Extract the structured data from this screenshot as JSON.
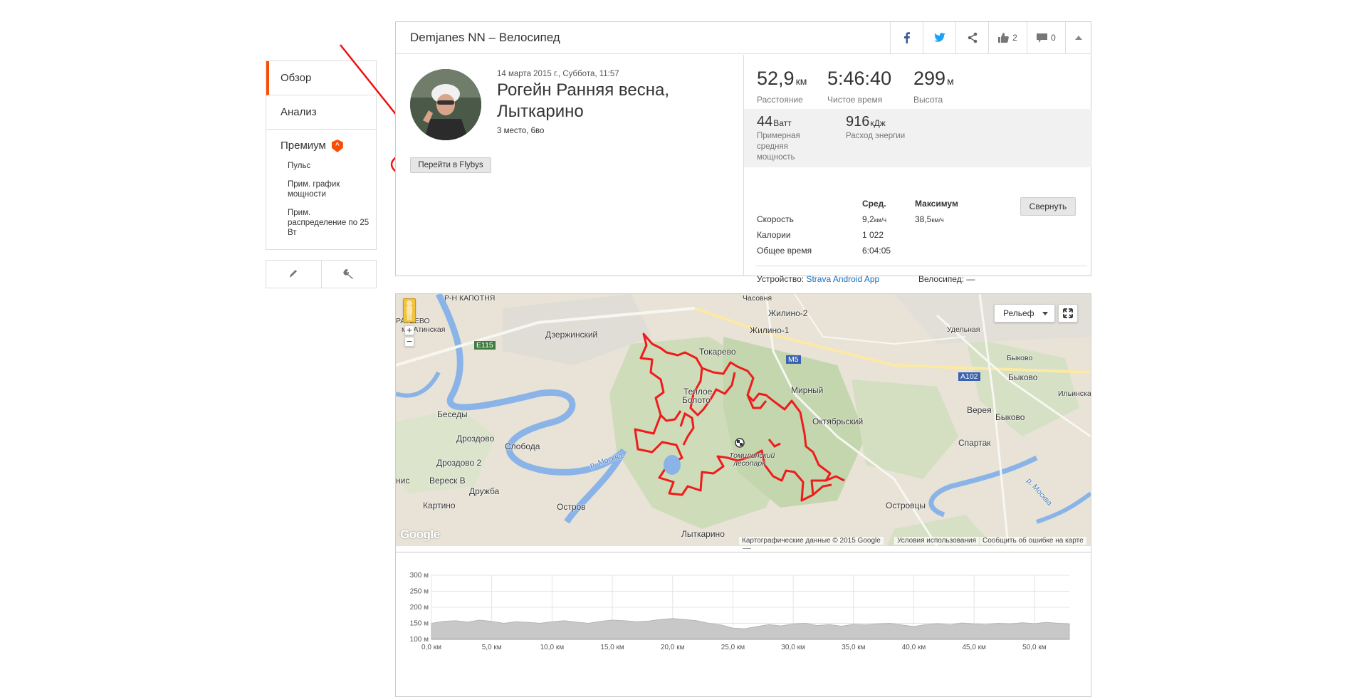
{
  "sidebar": {
    "items": [
      {
        "label": "Обзор"
      },
      {
        "label": "Анализ"
      }
    ],
    "premium": {
      "label": "Премиум",
      "badge": "^",
      "sub_items": [
        "Пульс",
        "Прим. график мощности",
        "Прим. распределение по 25 Вт"
      ]
    },
    "tools": [
      "pencil-icon",
      "wrench-icon"
    ]
  },
  "header": {
    "title": "Demjanes NN – Велосипед",
    "likes": "2",
    "comments": "0"
  },
  "activity": {
    "date": "14 марта 2015 г., Суббота, 11:57",
    "name": "Рогейн Ранняя весна, Лыткарино",
    "place": "3 место, 6во",
    "flyby_button": "Перейти в Flybys"
  },
  "stats": {
    "distance": {
      "value": "52,9",
      "unit": "км",
      "label": "Расстояние"
    },
    "moving_time": {
      "value": "5:46:40",
      "label": "Чистое время"
    },
    "elevation": {
      "value": "299",
      "unit": "м",
      "label": "Высота"
    },
    "power": {
      "value": "44",
      "unit": "Ватт",
      "label": "Примерная средняя мощность"
    },
    "energy": {
      "value": "916",
      "unit": "кДж",
      "label": "Расход энергии"
    },
    "table": {
      "col_avg": "Сред.",
      "col_max": "Максимум",
      "rows": [
        {
          "label": "Скорость",
          "avg": "9,2",
          "avg_unit": "км/ч",
          "max": "38,5",
          "max_unit": "км/ч"
        },
        {
          "label": "Калории",
          "avg": "1 022",
          "max": ""
        },
        {
          "label": "Общее время",
          "avg": "6:04:05",
          "max": ""
        }
      ]
    },
    "collapse_button": "Свернуть",
    "device_label": "Устройство:",
    "device_value": "Strava Android App",
    "bike_label": "Велосипед:",
    "bike_value": "—"
  },
  "map": {
    "type_button": "Рельеф",
    "attribution": [
      "Картографические данные © 2015 Google",
      "Условия использования",
      "Сообщить об ошибке на карте"
    ],
    "logo": "Google",
    "labels": [
      {
        "text": "Р-Н КАПОТНЯ",
        "cls": "sm"
      },
      {
        "text": "РАТЕЕВО",
        "cls": "sm"
      },
      {
        "text": "ма-Атинская",
        "cls": "sm"
      },
      {
        "text": "Часовня",
        "cls": "sm"
      },
      {
        "text": "Жилино-2",
        "cls": ""
      },
      {
        "text": "Жилино-1",
        "cls": ""
      },
      {
        "text": "Удельная",
        "cls": "sm"
      },
      {
        "text": "Дзержинский",
        "cls": ""
      },
      {
        "text": "Токарево",
        "cls": ""
      },
      {
        "text": "Быково",
        "cls": "sm"
      },
      {
        "text": "Быково",
        "cls": ""
      },
      {
        "text": "Мирный",
        "cls": ""
      },
      {
        "text": "Ильинская",
        "cls": "sm"
      },
      {
        "text": "Теплое",
        "cls": ""
      },
      {
        "text": "Болото",
        "cls": ""
      },
      {
        "text": "Верея",
        "cls": ""
      },
      {
        "text": "Беседы",
        "cls": ""
      },
      {
        "text": "Октябрьский",
        "cls": ""
      },
      {
        "text": "Быково",
        "cls": ""
      },
      {
        "text": "Дроздово",
        "cls": ""
      },
      {
        "text": "Слобода",
        "cls": ""
      },
      {
        "text": "Спартак",
        "cls": ""
      },
      {
        "text": "Томилинский",
        "cls": "sm"
      },
      {
        "text": "лесопарк",
        "cls": "sm"
      },
      {
        "text": "Дроздово 2",
        "cls": ""
      },
      {
        "text": "нис",
        "cls": ""
      },
      {
        "text": "Вереск В",
        "cls": ""
      },
      {
        "text": "Дружба",
        "cls": ""
      },
      {
        "text": "Картино",
        "cls": ""
      },
      {
        "text": "Остров",
        "cls": ""
      },
      {
        "text": "Островцы",
        "cls": ""
      },
      {
        "text": "Лыткарино",
        "cls": ""
      },
      {
        "text": "р. Москва",
        "cls": "sm"
      },
      {
        "text": "р. Москва",
        "cls": "sm"
      },
      {
        "text": "E115",
        "cls": "sm"
      },
      {
        "text": "M5",
        "cls": "sm"
      },
      {
        "text": "A102",
        "cls": "sm"
      }
    ]
  },
  "chart_data": {
    "type": "area",
    "xlabel": "",
    "ylabel": "",
    "y_ticks": [
      "300 м",
      "250 м",
      "200 м",
      "150 м",
      "100 м"
    ],
    "x_ticks": [
      "0,0 км",
      "5,0 км",
      "10,0 км",
      "15,0 км",
      "20,0 км",
      "25,0 км",
      "30,0 км",
      "35,0 км",
      "40,0 км",
      "45,0 км",
      "50,0 км"
    ],
    "xlim": [
      0,
      52.9
    ],
    "ylim": [
      100,
      300
    ],
    "series": [
      {
        "x": [
          0,
          1,
          2,
          3,
          4,
          5,
          6,
          7,
          8,
          9,
          10,
          11,
          12,
          13,
          14,
          15,
          16,
          17,
          18,
          19,
          20,
          21,
          22,
          23,
          24,
          25,
          26,
          27,
          28,
          29,
          30,
          31,
          32,
          33,
          34,
          35,
          36,
          37,
          38,
          39,
          40,
          41,
          42,
          43,
          44,
          45,
          46,
          47,
          48,
          49,
          50,
          51,
          52,
          52.9
        ],
        "values": [
          150,
          156,
          158,
          154,
          160,
          156,
          150,
          155,
          153,
          150,
          155,
          158,
          154,
          150,
          156,
          160,
          158,
          155,
          157,
          162,
          165,
          162,
          158,
          150,
          145,
          135,
          133,
          140,
          146,
          142,
          148,
          150,
          143,
          146,
          141,
          147,
          145,
          148,
          150,
          145,
          140,
          146,
          149,
          145,
          151,
          148,
          146,
          150,
          148,
          152,
          149,
          153,
          150,
          148
        ]
      }
    ],
    "grid": true
  },
  "colors": {
    "accent": "#fc4c02",
    "route": "#ee1c1c",
    "link": "#1a6fbf"
  }
}
